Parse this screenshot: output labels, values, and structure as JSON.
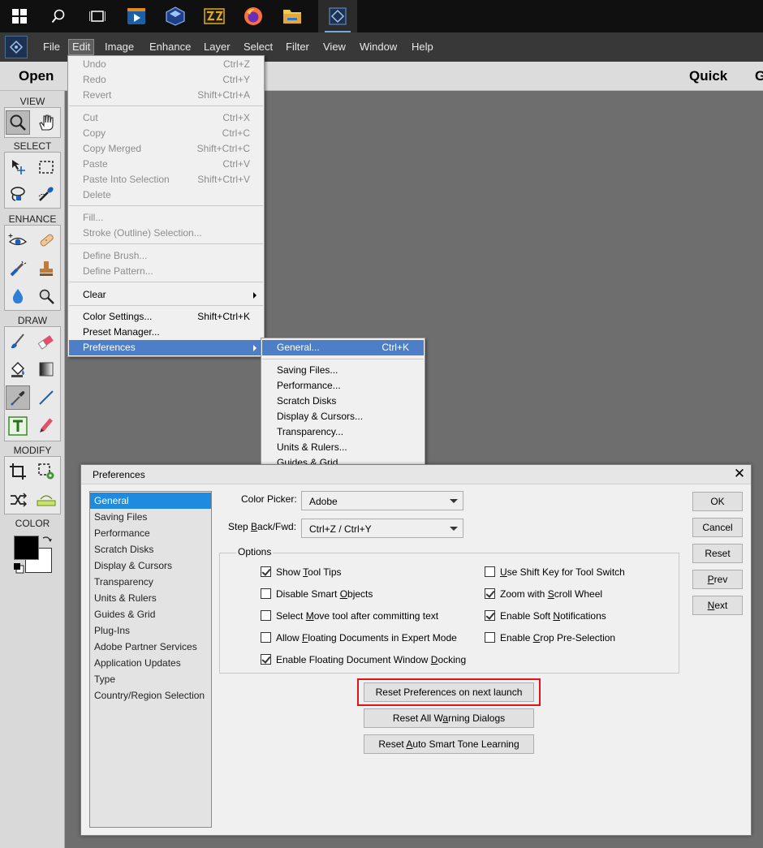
{
  "taskbar": {
    "icons": [
      "windows-start-icon",
      "search-icon",
      "task-view-icon",
      "media-player-icon",
      "virtualbox-icon",
      "archive-app-icon",
      "firefox-icon",
      "file-explorer-icon",
      "photoshop-elements-icon"
    ]
  },
  "menubar": {
    "items": [
      "File",
      "Edit",
      "Image",
      "Enhance",
      "Layer",
      "Select",
      "Filter",
      "View",
      "Window",
      "Help"
    ]
  },
  "modebar": {
    "open": "Open",
    "quick": "Quick",
    "g": "G"
  },
  "toolpanel": {
    "sections": [
      "VIEW",
      "SELECT",
      "ENHANCE",
      "DRAW",
      "MODIFY",
      "COLOR"
    ]
  },
  "edit_menu": {
    "items": [
      {
        "label": "Undo",
        "shortcut": "Ctrl+Z"
      },
      {
        "label": "Redo",
        "shortcut": "Ctrl+Y"
      },
      {
        "label": "Revert",
        "shortcut": "Shift+Ctrl+A"
      },
      {
        "label": "Cut",
        "shortcut": "Ctrl+X"
      },
      {
        "label": "Copy",
        "shortcut": "Ctrl+C"
      },
      {
        "label": "Copy Merged",
        "shortcut": "Shift+Ctrl+C"
      },
      {
        "label": "Paste",
        "shortcut": "Ctrl+V"
      },
      {
        "label": "Paste Into Selection",
        "shortcut": "Shift+Ctrl+V"
      },
      {
        "label": "Delete",
        "shortcut": ""
      },
      {
        "label": "Fill...",
        "shortcut": ""
      },
      {
        "label": "Stroke (Outline) Selection...",
        "shortcut": ""
      },
      {
        "label": "Define Brush...",
        "shortcut": ""
      },
      {
        "label": "Define Pattern...",
        "shortcut": ""
      },
      {
        "label": "Clear",
        "shortcut": ""
      },
      {
        "label": "Color Settings...",
        "shortcut": "Shift+Ctrl+K"
      },
      {
        "label": "Preset Manager...",
        "shortcut": ""
      },
      {
        "label": "Preferences",
        "shortcut": ""
      }
    ]
  },
  "preferences_submenu": {
    "items": [
      {
        "label": "General...",
        "shortcut": "Ctrl+K"
      },
      {
        "label": "Saving Files...",
        "shortcut": ""
      },
      {
        "label": "Performance...",
        "shortcut": ""
      },
      {
        "label": "Scratch Disks",
        "shortcut": ""
      },
      {
        "label": "Display & Cursors...",
        "shortcut": ""
      },
      {
        "label": "Transparency...",
        "shortcut": ""
      },
      {
        "label": "Units & Rulers...",
        "shortcut": ""
      },
      {
        "label": "Guides & Grid",
        "shortcut": ""
      }
    ]
  },
  "dialog": {
    "title": "Preferences",
    "categories": [
      "General",
      "Saving Files",
      "Performance",
      "Scratch Disks",
      "Display & Cursors",
      "Transparency",
      "Units & Rulers",
      "Guides & Grid",
      "Plug-Ins",
      "Adobe Partner Services",
      "Application Updates",
      "Type",
      "Country/Region Selection"
    ],
    "color_picker_label": "Color Picker:",
    "color_picker_value": "Adobe",
    "step_back_label_pre": "Step ",
    "step_back_label_acc": "B",
    "step_back_label_post": "ack/Fwd:",
    "step_back_value": "Ctrl+Z / Ctrl+Y",
    "options_title": "Options",
    "options": [
      {
        "pre": "Show ",
        "acc": "T",
        "post": "ool Tips",
        "checked": true
      },
      {
        "pre": "Disable Smart ",
        "acc": "O",
        "post": "bjects",
        "checked": false
      },
      {
        "pre": "Select ",
        "acc": "M",
        "post": "ove tool after committing text",
        "checked": false
      },
      {
        "pre": "Allow ",
        "acc": "F",
        "post": "loating Documents in Expert Mode",
        "checked": false
      },
      {
        "pre": "Enable Floating Document Window ",
        "acc": "D",
        "post": "ocking",
        "checked": true
      },
      {
        "pre": "",
        "acc": "U",
        "post": "se Shift Key for Tool Switch",
        "checked": false
      },
      {
        "pre": "Zoom with ",
        "acc": "S",
        "post": "croll Wheel",
        "checked": true
      },
      {
        "pre": "Enable Soft ",
        "acc": "N",
        "post": "otifications",
        "checked": true
      },
      {
        "pre": "Enable ",
        "acc": "C",
        "post": "rop Pre-Selection",
        "checked": false
      }
    ],
    "reset_prefs_button": "Reset Preferences on next launch",
    "reset_warn_pre": "Reset All W",
    "reset_warn_acc": "a",
    "reset_warn_post": "rning Dialogs",
    "reset_smart_pre": "Reset ",
    "reset_smart_acc": "A",
    "reset_smart_post": "uto Smart Tone Learning",
    "ok": "OK",
    "cancel": "Cancel",
    "reset": "Reset",
    "prev_acc": "P",
    "prev_post": "rev",
    "next_acc": "N",
    "next_post": "ext"
  },
  "colors": {
    "highlight": "#4c7fc7",
    "selected_category": "#1e8be0",
    "emphasis_box": "#e0141a"
  }
}
